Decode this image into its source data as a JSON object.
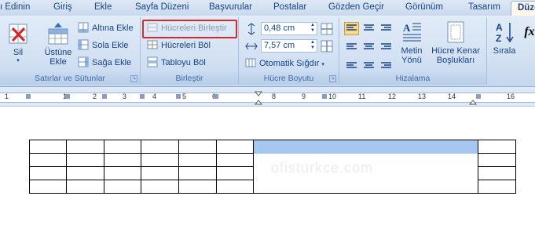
{
  "tabs": [
    "ı Edinin",
    "Giriş",
    "Ekle",
    "Sayfa Düzeni",
    "Başvurular",
    "Postalar",
    "Gözden Geçir",
    "Görünüm",
    "Tasarım",
    "Düzen"
  ],
  "groups": {
    "rows_cols": {
      "label": "Satırlar ve Sütunlar",
      "delete_label": "Sil",
      "insert_above_line1": "Üstüne",
      "insert_above_line2": "Ekle",
      "insert_below": "Altına Ekle",
      "insert_left": "Sola Ekle",
      "insert_right": "Sağa Ekle"
    },
    "merge": {
      "label": "Birleştir",
      "merge_cells": "Hücreleri Birleştir",
      "split_cells": "Hücreleri Böl",
      "split_table": "Tabloyu Böl"
    },
    "cell_size": {
      "label": "Hücre Boyutu",
      "height": "0,48 cm",
      "width": "7,57 cm",
      "autofit": "Otomatik Sığdır"
    },
    "alignment": {
      "label": "Hizalama",
      "text_direction_line1": "Metin",
      "text_direction_line2": "Yönü",
      "cell_margins_line1": "Hücre Kenar",
      "cell_margins_line2": "Boşlukları"
    },
    "data": {
      "sort": "Sırala",
      "formula": "fx"
    }
  },
  "ruler": {
    "numbers": [
      "1",
      "1",
      "2",
      "3",
      "4",
      "5",
      "6",
      "7",
      "8",
      "9",
      "10",
      "11",
      "12",
      "13",
      "14",
      "15",
      "16"
    ]
  },
  "colors": {
    "selection": "#a6c8f0",
    "highlight": "#d62b2b",
    "active_align": "#fbd888"
  },
  "watermark": "ofisturkce.com"
}
